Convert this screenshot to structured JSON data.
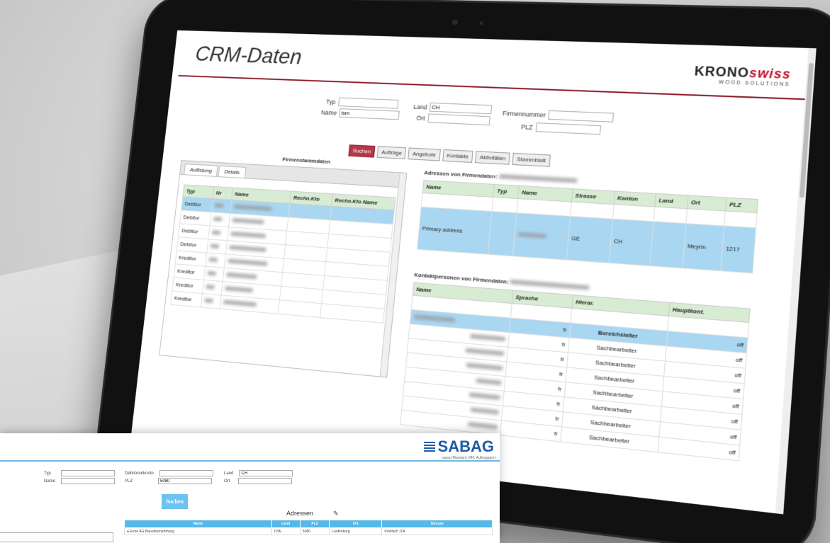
{
  "crm": {
    "title": "CRM-Daten",
    "logo": {
      "brand": "KRONO",
      "brand_accent": "swiss",
      "tagline": "WOOD SOLUTIONS"
    },
    "search": {
      "typ_label": "Typ",
      "name_label": "Name",
      "name_value": "ism",
      "land_label": "Land",
      "land_value": "CH",
      "ort_label": "Ort",
      "firmennummer_label": "Firmennummer",
      "plz_label": "PLZ"
    },
    "buttons": [
      "Suchen",
      "Aufträge",
      "Angebote",
      "Kontakte",
      "Aktivitäten",
      "Stammblatt"
    ],
    "firmenstamm": {
      "title": "Firmenstammdaten",
      "tabs": [
        "Auflistung",
        "Details"
      ],
      "columns": [
        "Typ",
        "Nr",
        "Name",
        "Rechn.Kto",
        "Rechn.Kto Name"
      ],
      "rows": [
        "Debitor",
        "Debitor",
        "Debitor",
        "Debitor",
        "Kreditor",
        "Kreditor",
        "Kreditor",
        "Kreditor"
      ]
    },
    "adressen": {
      "title": "Adressen von Firmendaten:",
      "columns": [
        "Name",
        "Typ",
        "Name",
        "Strasse",
        "Kanton",
        "Land",
        "Ort",
        "PLZ"
      ],
      "row": {
        "name": "Primary address",
        "kanton": "GE",
        "land": "CH",
        "ort": "Meyrin",
        "plz": "1217"
      }
    },
    "kontakt": {
      "title": "Kontaktpersonen von Firmendaten:",
      "columns": [
        "Name",
        "Sprache",
        "Hierar.",
        "Hauptkont."
      ],
      "rows": [
        {
          "sprache": "fr",
          "hierar": "Bereichsleiter",
          "haupt": "off"
        },
        {
          "sprache": "fr",
          "hierar": "Sachbearbeiter",
          "haupt": "off"
        },
        {
          "sprache": "fr",
          "hierar": "Sachbearbeiter",
          "haupt": "off"
        },
        {
          "sprache": "fr",
          "hierar": "Sachbearbeiter",
          "haupt": "off"
        },
        {
          "sprache": "fr",
          "hierar": "Sachbearbeiter",
          "haupt": "off"
        },
        {
          "sprache": "fr",
          "hierar": "Sachbearbeiter",
          "haupt": "off"
        },
        {
          "sprache": "fr",
          "hierar": "Sachbearbeiter",
          "haupt": "off"
        },
        {
          "sprache": "fr",
          "hierar": "Sachbearbeiter",
          "haupt": "off"
        }
      ]
    }
  },
  "sabag": {
    "logo": "SABAG",
    "subtitle": "rapsa (Mandant: 840; Auftragsport",
    "typ_label": "Typ",
    "name_label": "Name",
    "debitor_label": "Debitorenkonto",
    "plz_label": "PLZ",
    "plz_value": "5080",
    "land_label": "Land",
    "land_value": "CH",
    "ort_label": "Ort",
    "search_button": "Suchen",
    "adressen_title": "Adressen",
    "columns": [
      "Name",
      "Land",
      "PLZ",
      "Ort",
      "Strasse"
    ],
    "row": {
      "name": "Ernie AG Bauunternehmung",
      "land": "CHE",
      "plz": "5080",
      "ort": "Laufenburg",
      "strasse": "Postfach 104"
    }
  }
}
